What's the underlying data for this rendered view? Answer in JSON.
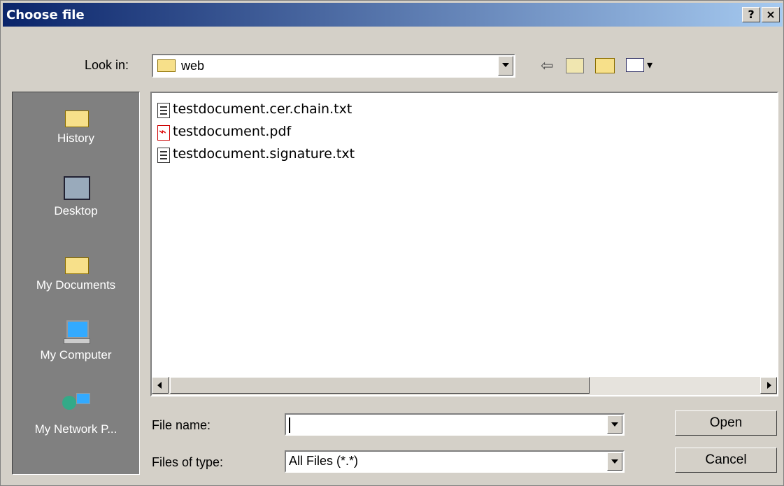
{
  "window": {
    "title": "Choose file",
    "help_label": "?",
    "close_label": "×"
  },
  "lookin": {
    "label": "Look in:",
    "value": "web"
  },
  "places": [
    {
      "label": "History",
      "icon": "history-folder-icon"
    },
    {
      "label": "Desktop",
      "icon": "desktop-icon"
    },
    {
      "label": "My Documents",
      "icon": "documents-folder-icon"
    },
    {
      "label": "My Computer",
      "icon": "computer-icon"
    },
    {
      "label": "My Network P...",
      "icon": "network-places-icon"
    }
  ],
  "files": [
    {
      "name": "testdocument.cer.chain.txt",
      "icon": "text-file-icon"
    },
    {
      "name": "testdocument.pdf",
      "icon": "pdf-file-icon"
    },
    {
      "name": "testdocument.signature.txt",
      "icon": "text-file-icon"
    }
  ],
  "filename": {
    "label": "File name:",
    "value": ""
  },
  "filetype": {
    "label": "Files of type:",
    "value": "All Files (*.*)"
  },
  "buttons": {
    "open": "Open",
    "cancel": "Cancel"
  },
  "colors": {
    "title_start": "#0a246a",
    "title_end": "#a6caf0",
    "face": "#d4d0c8",
    "places_bg": "#808080"
  }
}
